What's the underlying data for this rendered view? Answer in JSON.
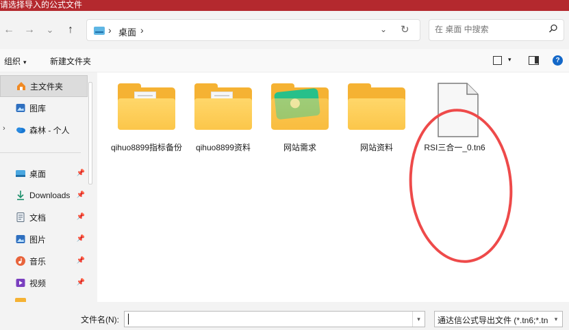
{
  "window": {
    "title": "请选择导入的公式文件"
  },
  "nav": {
    "back_icon": "←",
    "forward_icon": "→",
    "recent_icon": "⌄",
    "up_icon": "↑",
    "address_crumb": "桌面",
    "address_sep": "›",
    "address_dropdown": "⌄",
    "refresh_icon": "↻",
    "search_placeholder": "在 桌面 中搜索"
  },
  "commands": {
    "organize": "组织",
    "new_folder": "新建文件夹",
    "caret": "▾",
    "help": "?"
  },
  "sidebar": {
    "items": [
      {
        "label": "主文件夹",
        "icon": "home-icon",
        "selected": true
      },
      {
        "label": "图库",
        "icon": "gallery-icon"
      },
      {
        "label": "森林 - 个人",
        "icon": "cloud-icon",
        "expandable": true
      },
      {
        "label": "桌面",
        "icon": "desktop-icon",
        "pinned": true
      },
      {
        "label": "Downloads",
        "icon": "download-icon",
        "pinned": true
      },
      {
        "label": "文档",
        "icon": "documents-icon",
        "pinned": true
      },
      {
        "label": "图片",
        "icon": "pictures-icon",
        "pinned": true
      },
      {
        "label": "音乐",
        "icon": "music-icon",
        "pinned": true
      },
      {
        "label": "视频",
        "icon": "videos-icon",
        "pinned": true
      }
    ],
    "pin_glyph": "📌",
    "expand_glyph": "›"
  },
  "files": [
    {
      "name": "qihuo8899指标备份",
      "type": "folder-docs"
    },
    {
      "name": "qihuo8899资料",
      "type": "folder-docs"
    },
    {
      "name": "网站需求",
      "type": "folder-green"
    },
    {
      "name": "网站资料",
      "type": "folder"
    },
    {
      "name": "RSI三合一_0.tn6",
      "type": "file"
    }
  ],
  "footer": {
    "filename_label": "文件名(N):",
    "filename_value": "",
    "filetype_value": "通达信公式导出文件 (*.tn6;*.tn",
    "dropdown_glyph": "▾"
  },
  "colors": {
    "titlebar": "#b4292e",
    "folder": "#f5b233",
    "annotation": "#ee4a4a",
    "accent": "#1468c8"
  }
}
